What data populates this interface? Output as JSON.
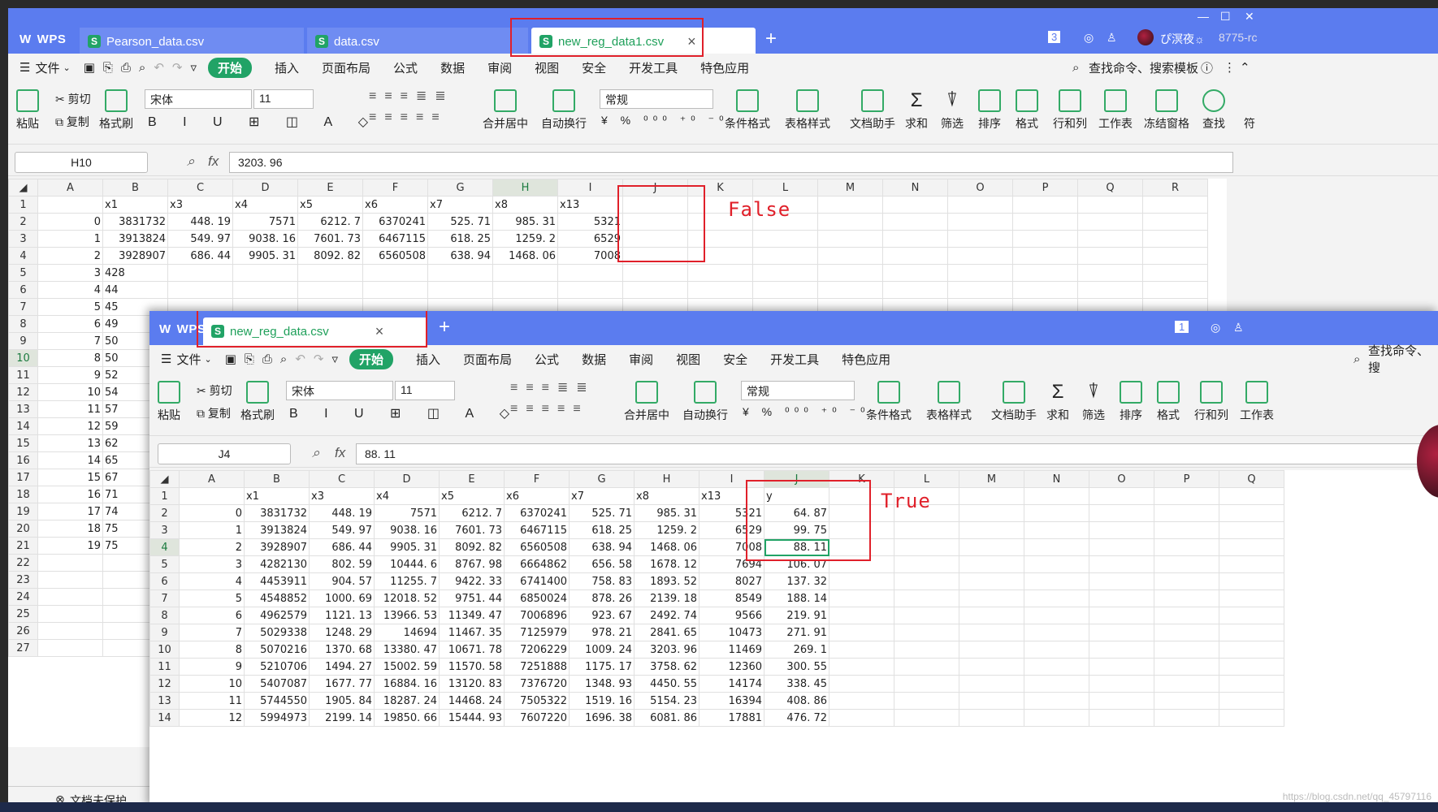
{
  "window1": {
    "tabs": [
      {
        "label": "WPS",
        "type": "logo"
      },
      {
        "label": "Pearson_data.csv"
      },
      {
        "label": "data.csv"
      },
      {
        "label": "new_reg_data1.csv",
        "active": true
      }
    ],
    "tab_count": "3",
    "user_label": "ぴ溟夜☼",
    "user_code": "8775-rc",
    "menu": [
      "文件",
      "开始",
      "插入",
      "页面布局",
      "公式",
      "数据",
      "审阅",
      "视图",
      "安全",
      "开发工具",
      "特色应用"
    ],
    "search_label": "查找命令、搜索模板",
    "ribbon": {
      "paste": "粘贴",
      "cut": "剪切",
      "copy": "复制",
      "format_painter": "格式刷",
      "font": "宋体",
      "font_size": "11",
      "merge": "合并居中",
      "wrap": "自动换行",
      "number_format": "常规",
      "cond_format": "条件格式",
      "table_style": "表格样式",
      "doc_helper": "文档助手",
      "sum": "求和",
      "filter": "筛选",
      "sort": "排序",
      "format": "格式",
      "row_col": "行和列",
      "worksheet": "工作表",
      "freeze": "冻结窗格",
      "find": "查找",
      "symbol": "符"
    },
    "name_box": "H10",
    "formula": "3203. 96",
    "col_headers": [
      "A",
      "B",
      "C",
      "D",
      "E",
      "F",
      "G",
      "H",
      "I",
      "J",
      "K",
      "L",
      "M",
      "N",
      "O",
      "P",
      "Q",
      "R"
    ],
    "header_row": [
      "",
      "x1",
      "x3",
      "x4",
      "x5",
      "x6",
      "x7",
      "x8",
      "x13"
    ],
    "rows": [
      [
        "0",
        "3831732",
        "448. 19",
        "7571",
        "6212. 7",
        "6370241",
        "525. 71",
        "985. 31",
        "5321"
      ],
      [
        "1",
        "3913824",
        "549. 97",
        "9038. 16",
        "7601. 73",
        "6467115",
        "618. 25",
        "1259. 2",
        "6529"
      ],
      [
        "2",
        "3928907",
        "686. 44",
        "9905. 31",
        "8092. 82",
        "6560508",
        "638. 94",
        "1468. 06",
        "7008"
      ]
    ],
    "partial_a": [
      "3",
      "4",
      "5",
      "6",
      "7",
      "8",
      "9",
      "10",
      "11",
      "12",
      "13",
      "14",
      "15",
      "16",
      "17",
      "18",
      "19"
    ],
    "partial_b": [
      "428",
      "44",
      "45",
      "49",
      "50",
      "50",
      "52",
      "54",
      "57",
      "59",
      "62",
      "65",
      "67",
      "71",
      "74",
      "75",
      "75"
    ],
    "row_numbers": [
      "1",
      "2",
      "3",
      "4",
      "5",
      "6",
      "7",
      "8",
      "9",
      "10",
      "11",
      "12",
      "13",
      "14",
      "15",
      "16",
      "17",
      "18",
      "19",
      "20",
      "21",
      "22",
      "23",
      "24",
      "25",
      "26",
      "27"
    ],
    "annotation": "False",
    "status": "文档未保护"
  },
  "window2": {
    "tabs": [
      {
        "label": "WPS",
        "type": "logo"
      },
      {
        "label": "new_reg_data.csv",
        "active": true
      }
    ],
    "tab_count": "1",
    "menu": [
      "文件",
      "开始",
      "插入",
      "页面布局",
      "公式",
      "数据",
      "审阅",
      "视图",
      "安全",
      "开发工具",
      "特色应用"
    ],
    "search_label": "查找命令、搜",
    "ribbon": {
      "paste": "粘贴",
      "cut": "剪切",
      "copy": "复制",
      "format_painter": "格式刷",
      "font": "宋体",
      "font_size": "11",
      "merge": "合并居中",
      "wrap": "自动换行",
      "number_format": "常规",
      "cond_format": "条件格式",
      "table_style": "表格样式",
      "doc_helper": "文档助手",
      "sum": "求和",
      "filter": "筛选",
      "sort": "排序",
      "format": "格式",
      "row_col": "行和列",
      "worksheet": "工作表"
    },
    "name_box": "J4",
    "formula": "88. 11",
    "col_headers": [
      "A",
      "B",
      "C",
      "D",
      "E",
      "F",
      "G",
      "H",
      "I",
      "J",
      "K",
      "L",
      "M",
      "N",
      "O",
      "P",
      "Q"
    ],
    "header_row": [
      "",
      "x1",
      "x3",
      "x4",
      "x5",
      "x6",
      "x7",
      "x8",
      "x13",
      "y"
    ],
    "rows": [
      [
        "0",
        "3831732",
        "448. 19",
        "7571",
        "6212. 7",
        "6370241",
        "525. 71",
        "985. 31",
        "5321",
        "64. 87"
      ],
      [
        "1",
        "3913824",
        "549. 97",
        "9038. 16",
        "7601. 73",
        "6467115",
        "618. 25",
        "1259. 2",
        "6529",
        "99. 75"
      ],
      [
        "2",
        "3928907",
        "686. 44",
        "9905. 31",
        "8092. 82",
        "6560508",
        "638. 94",
        "1468. 06",
        "7008",
        "88. 11"
      ],
      [
        "3",
        "4282130",
        "802. 59",
        "10444. 6",
        "8767. 98",
        "6664862",
        "656. 58",
        "1678. 12",
        "7694",
        "106. 07"
      ],
      [
        "4",
        "4453911",
        "904. 57",
        "11255. 7",
        "9422. 33",
        "6741400",
        "758. 83",
        "1893. 52",
        "8027",
        "137. 32"
      ],
      [
        "5",
        "4548852",
        "1000. 69",
        "12018. 52",
        "9751. 44",
        "6850024",
        "878. 26",
        "2139. 18",
        "8549",
        "188. 14"
      ],
      [
        "6",
        "4962579",
        "1121. 13",
        "13966. 53",
        "11349. 47",
        "7006896",
        "923. 67",
        "2492. 74",
        "9566",
        "219. 91"
      ],
      [
        "7",
        "5029338",
        "1248. 29",
        "14694",
        "11467. 35",
        "7125979",
        "978. 21",
        "2841. 65",
        "10473",
        "271. 91"
      ],
      [
        "8",
        "5070216",
        "1370. 68",
        "13380. 47",
        "10671. 78",
        "7206229",
        "1009. 24",
        "3203. 96",
        "11469",
        "269. 1"
      ],
      [
        "9",
        "5210706",
        "1494. 27",
        "15002. 59",
        "11570. 58",
        "7251888",
        "1175. 17",
        "3758. 62",
        "12360",
        "300. 55"
      ],
      [
        "10",
        "5407087",
        "1677. 77",
        "16884. 16",
        "13120. 83",
        "7376720",
        "1348. 93",
        "4450. 55",
        "14174",
        "338. 45"
      ],
      [
        "11",
        "5744550",
        "1905. 84",
        "18287. 24",
        "14468. 24",
        "7505322",
        "1519. 16",
        "5154. 23",
        "16394",
        "408. 86"
      ],
      [
        "12",
        "5994973",
        "2199. 14",
        "19850. 66",
        "15444. 93",
        "7607220",
        "1696. 38",
        "6081. 86",
        "17881",
        "476. 72"
      ]
    ],
    "annotation": "True"
  },
  "watermark": "https://blog.csdn.net/qq_45797116"
}
